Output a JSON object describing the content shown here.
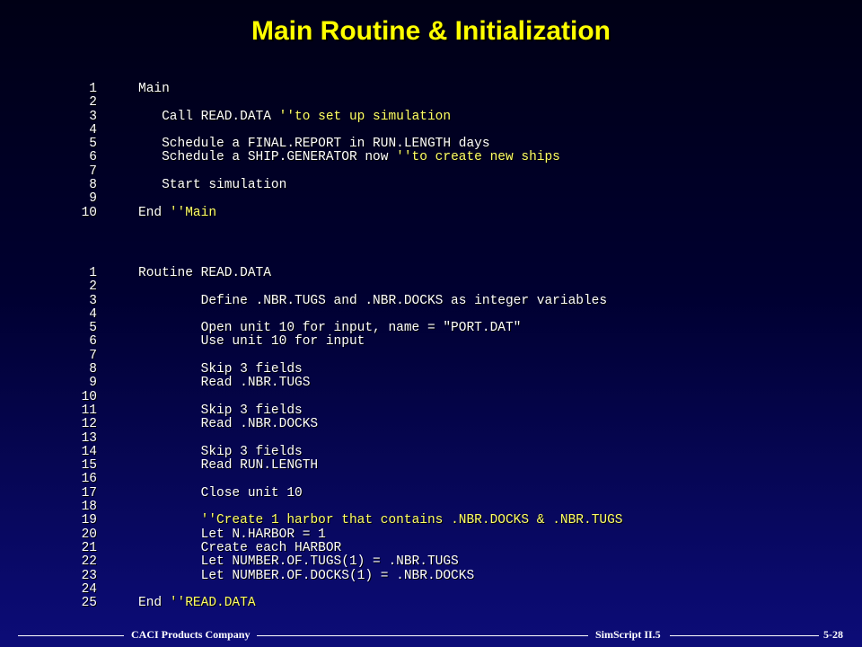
{
  "title": "Main Routine & Initialization",
  "main_routine": [
    {
      "n": "1",
      "code": "Main",
      "comment": ""
    },
    {
      "n": "2",
      "code": "",
      "comment": ""
    },
    {
      "n": "3",
      "code": "   Call READ.DATA ",
      "comment": "''to set up simulation"
    },
    {
      "n": "4",
      "code": "",
      "comment": ""
    },
    {
      "n": "5",
      "code": "   Schedule a FINAL.REPORT in RUN.LENGTH days",
      "comment": ""
    },
    {
      "n": "6",
      "code": "   Schedule a SHIP.GENERATOR now ",
      "comment": "''to create new ships"
    },
    {
      "n": "7",
      "code": "",
      "comment": ""
    },
    {
      "n": "8",
      "code": "   Start simulation",
      "comment": ""
    },
    {
      "n": "9",
      "code": "",
      "comment": ""
    },
    {
      "n": "10",
      "code": "End ",
      "comment": "''Main"
    }
  ],
  "read_data_routine": [
    {
      "n": "1",
      "code": "Routine READ.DATA",
      "comment": ""
    },
    {
      "n": "2",
      "code": "",
      "comment": ""
    },
    {
      "n": "3",
      "code": "        Define .NBR.TUGS and .NBR.DOCKS as integer variables",
      "comment": ""
    },
    {
      "n": "4",
      "code": "",
      "comment": ""
    },
    {
      "n": "5",
      "code": "        Open unit 10 for input, name = \"PORT.DAT\"",
      "comment": ""
    },
    {
      "n": "6",
      "code": "        Use unit 10 for input",
      "comment": ""
    },
    {
      "n": "7",
      "code": "",
      "comment": ""
    },
    {
      "n": "8",
      "code": "        Skip 3 fields",
      "comment": ""
    },
    {
      "n": "9",
      "code": "        Read .NBR.TUGS",
      "comment": ""
    },
    {
      "n": "10",
      "code": "",
      "comment": ""
    },
    {
      "n": "11",
      "code": "        Skip 3 fields",
      "comment": ""
    },
    {
      "n": "12",
      "code": "        Read .NBR.DOCKS",
      "comment": ""
    },
    {
      "n": "13",
      "code": "",
      "comment": ""
    },
    {
      "n": "14",
      "code": "        Skip 3 fields",
      "comment": ""
    },
    {
      "n": "15",
      "code": "        Read RUN.LENGTH",
      "comment": ""
    },
    {
      "n": "16",
      "code": "",
      "comment": ""
    },
    {
      "n": "17",
      "code": "        Close unit 10",
      "comment": ""
    },
    {
      "n": "18",
      "code": "",
      "comment": ""
    },
    {
      "n": "19",
      "code": "        ",
      "comment": "''Create 1 harbor that contains .NBR.DOCKS & .NBR.TUGS"
    },
    {
      "n": "20",
      "code": "        Let N.HARBOR = 1",
      "comment": ""
    },
    {
      "n": "21",
      "code": "        Create each HARBOR",
      "comment": ""
    },
    {
      "n": "22",
      "code": "        Let NUMBER.OF.TUGS(1) = .NBR.TUGS",
      "comment": ""
    },
    {
      "n": "23",
      "code": "        Let NUMBER.OF.DOCKS(1) = .NBR.DOCKS",
      "comment": ""
    },
    {
      "n": "24",
      "code": "",
      "comment": ""
    },
    {
      "n": "25",
      "code": "End ",
      "comment": "''READ.DATA"
    }
  ],
  "footer": {
    "company": "CACI Products Company",
    "product": "SimScript II.5",
    "page": "5-28"
  },
  "colors": {
    "title": "#ffff00",
    "code_text": "#ffffff",
    "comment": "#ffff66"
  }
}
